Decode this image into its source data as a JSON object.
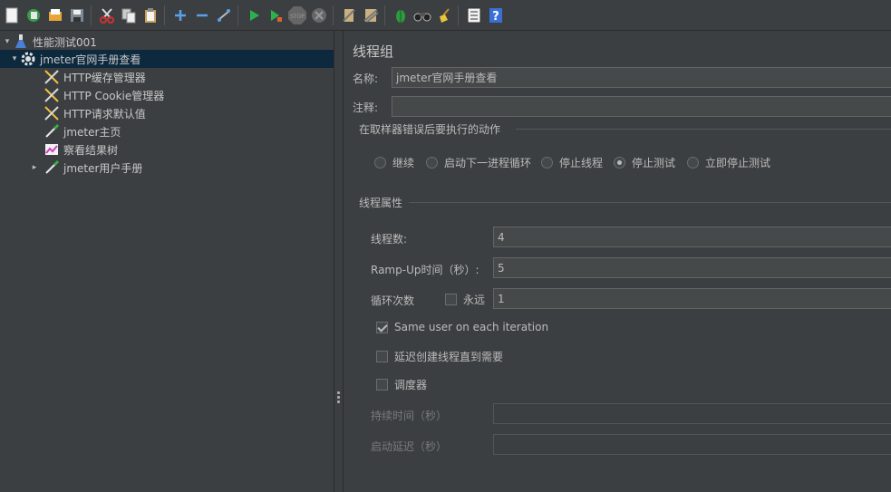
{
  "toolbar": {
    "icons": [
      "new-icon",
      "templates-icon",
      "open-icon",
      "save-icon",
      "cut-icon",
      "copy-icon",
      "paste-icon",
      "expand-icon",
      "collapse-icon",
      "toggle-icon",
      "start-icon",
      "start-no-pause-icon",
      "stop-icon",
      "shutdown-icon",
      "clear-icon",
      "clear-all-icon",
      "search-icon",
      "binoculars-icon",
      "broom-icon",
      "function-helper-icon",
      "help-icon"
    ]
  },
  "tree": {
    "items": [
      {
        "label": "性能测试001",
        "icon": "test-plan-icon"
      },
      {
        "label": "jmeter官网手册查看",
        "icon": "thread-group-gear-icon"
      },
      {
        "label": "HTTP缓存管理器",
        "icon": "config-tools-icon"
      },
      {
        "label": "HTTP Cookie管理器",
        "icon": "config-tools-icon"
      },
      {
        "label": "HTTP请求默认值",
        "icon": "config-tools-icon"
      },
      {
        "label": "jmeter主页",
        "icon": "sampler-pipette-icon"
      },
      {
        "label": "察看结果树",
        "icon": "listener-chart-icon"
      },
      {
        "label": "jmeter用户手册",
        "icon": "sampler-pipette-icon"
      }
    ]
  },
  "panel": {
    "title": "线程组",
    "name_label": "名称:",
    "name_value": "jmeter官网手册查看",
    "comment_label": "注释:",
    "comment_value": "",
    "error_section": "在取样器错误后要执行的动作",
    "error_actions": [
      {
        "label": "继续",
        "selected": false
      },
      {
        "label": "启动下一进程循环",
        "selected": false
      },
      {
        "label": "停止线程",
        "selected": false
      },
      {
        "label": "停止测试",
        "selected": true
      },
      {
        "label": "立即停止测试",
        "selected": false
      }
    ],
    "thread_section": "线程属性",
    "threads_label": "线程数:",
    "threads_value": "4",
    "rampup_label": "Ramp-Up时间（秒）:",
    "rampup_value": "5",
    "loop_label": "循环次数",
    "forever_label": "永远",
    "forever_checked": false,
    "loop_value": "1",
    "same_user_label": "Same user on each iteration",
    "same_user_checked": true,
    "delay_label": "延迟创建线程直到需要",
    "delay_checked": false,
    "scheduler_label": "调度器",
    "scheduler_checked": false,
    "duration_label": "持续时间（秒）",
    "duration_value": "",
    "startup_delay_label": "启动延迟（秒）",
    "startup_delay_value": ""
  }
}
